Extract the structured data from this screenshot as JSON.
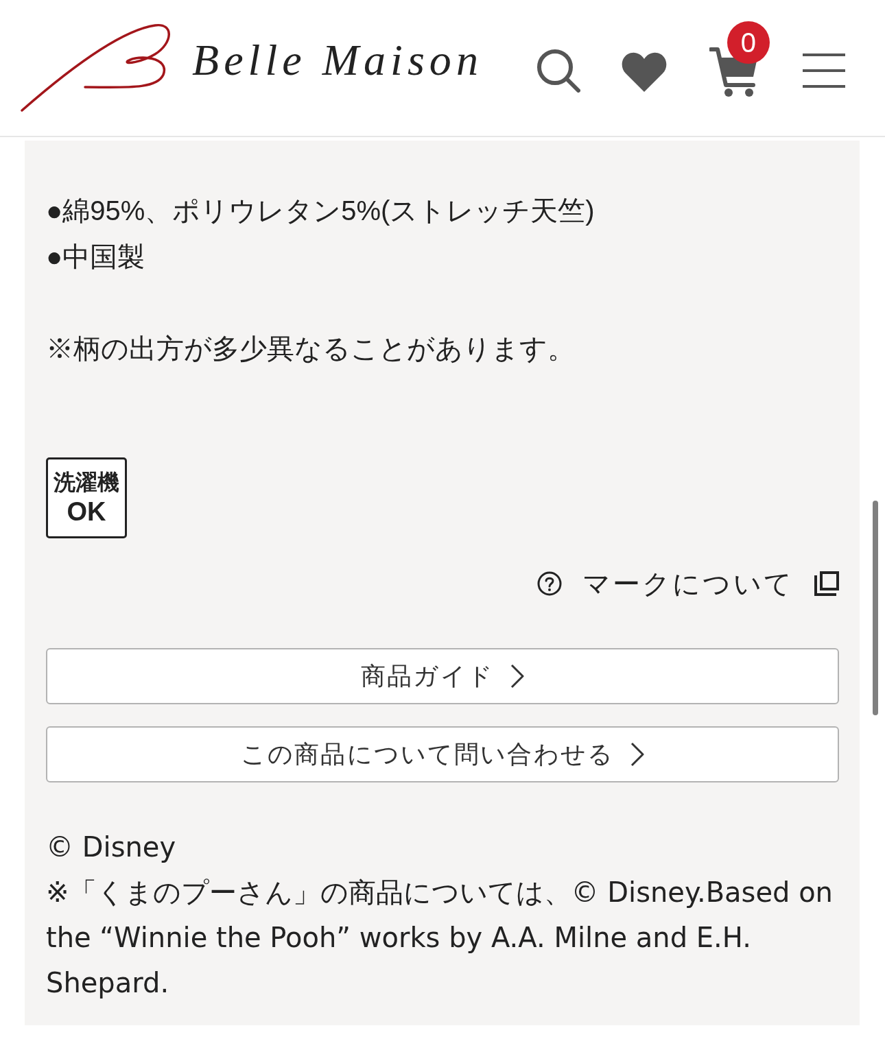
{
  "header": {
    "logo_text": "Belle Maison",
    "cart_count": "0"
  },
  "description": {
    "bullets": [
      "●綿95%、ポリウレタン5%(ストレッチ天竺)",
      "●中国製"
    ],
    "note": "※柄の出方が多少異なることがあります。"
  },
  "care_marks": [
    {
      "lines": [
        "洗濯機",
        "OK"
      ]
    }
  ],
  "mark_link": {
    "label": "マークについて"
  },
  "buttons": [
    {
      "label": "商品ガイド"
    },
    {
      "label": "この商品について問い合わせる"
    }
  ],
  "copyright": {
    "line": "© Disney",
    "notice": "※「くまのプーさん」の商品については、© Disney.Based on the “Winnie the Pooh” works by A.A. Milne and E.H. Shepard."
  }
}
